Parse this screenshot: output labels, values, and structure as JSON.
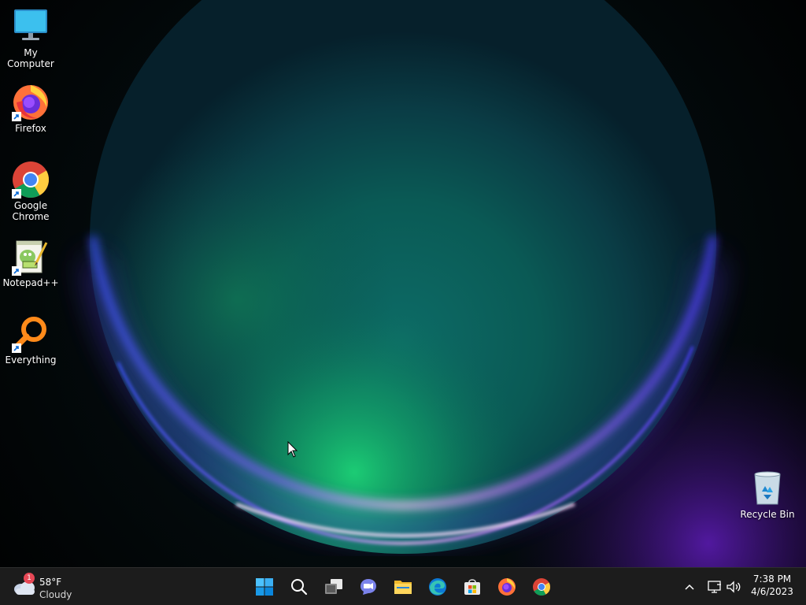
{
  "desktop": {
    "icons": [
      {
        "label": "My Computer"
      },
      {
        "label": "Firefox"
      },
      {
        "label": "Google Chrome"
      },
      {
        "label": "Notepad++"
      },
      {
        "label": "Everything"
      },
      {
        "label": "Recycle Bin"
      }
    ]
  },
  "taskbar": {
    "weather": {
      "temperature": "58°F",
      "condition": "Cloudy",
      "badge": "1",
      "icon": "cloud-icon"
    },
    "pinned": [
      {
        "name": "start",
        "icon": "windows-logo-icon"
      },
      {
        "name": "search",
        "icon": "search-icon"
      },
      {
        "name": "task-view",
        "icon": "task-view-icon"
      },
      {
        "name": "chat",
        "icon": "teams-chat-icon"
      },
      {
        "name": "file-explorer",
        "icon": "folder-icon"
      },
      {
        "name": "edge",
        "icon": "edge-icon"
      },
      {
        "name": "store",
        "icon": "store-icon"
      },
      {
        "name": "firefox",
        "icon": "firefox-icon"
      },
      {
        "name": "chrome",
        "icon": "chrome-icon"
      }
    ],
    "clock": {
      "time": "7:38 PM",
      "date": "4/6/2023"
    }
  },
  "colors": {
    "taskbar_bg": "#1c1c1c",
    "accent": "#0078d4"
  }
}
